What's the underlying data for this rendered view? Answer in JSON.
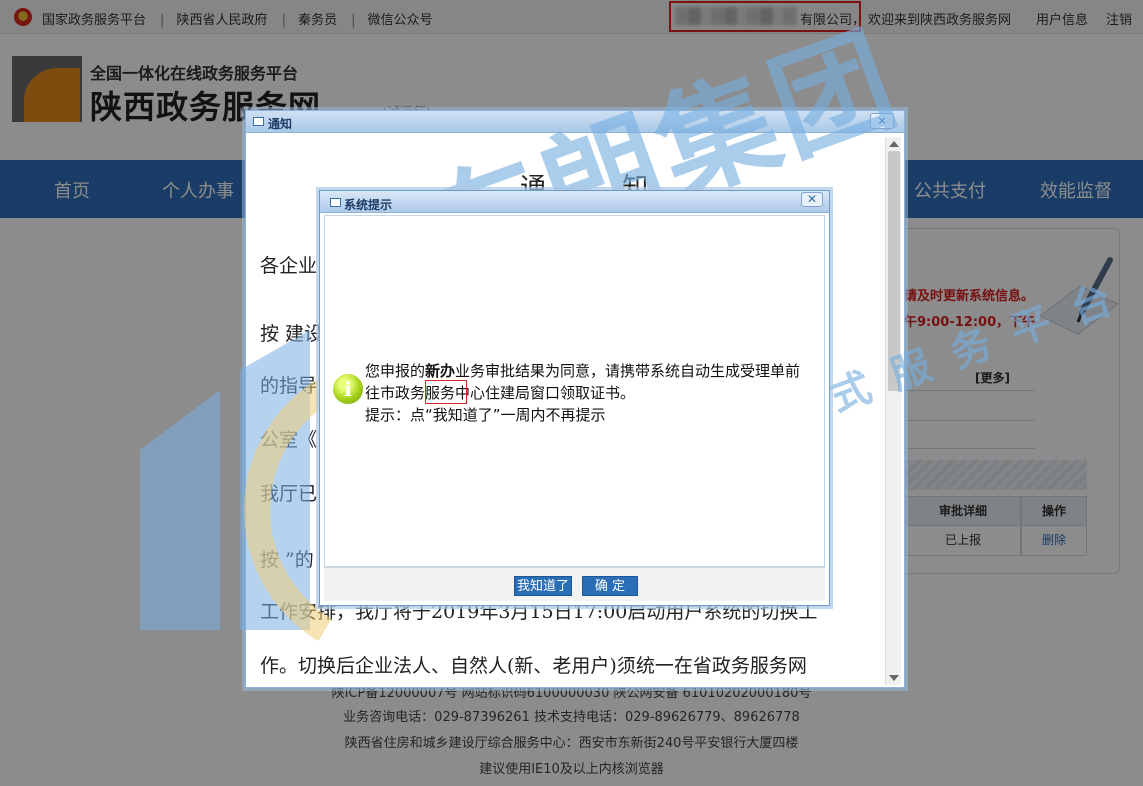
{
  "topbar": {
    "links": [
      "国家政务服务平台",
      "陕西省人民政府",
      "秦务员",
      "微信公众号"
    ],
    "company_suffix": "有限公司，",
    "welcome": "欢迎来到陕西政务服务网",
    "user_info": "用户信息",
    "logout": "注销"
  },
  "header": {
    "subtitle": "全国一体化在线政务服务平台",
    "title": "陕西政务服务网",
    "trial": "(试运行)"
  },
  "nav": {
    "items": [
      "首页",
      "个人办事",
      "公共支付",
      "效能监督"
    ]
  },
  "right_panel": {
    "red_line1": "请及时更新系统信息。",
    "red_line2": "午9:00-12:00，下午",
    "more": "[更多]",
    "table_headers": [
      "审批详细",
      "操作"
    ],
    "table_row": [
      "已上报",
      "删除"
    ]
  },
  "footer": {
    "line1": "陕ICP备12000007号   网站标识码6100000030   陕公网安备 61010202000180号",
    "line2": "业务咨询电话：029-87396261  技术支持电话：029-89626779、89626778",
    "line3": "陕西省住房和城乡建设厅综合服务中心：西安市东新街240号平安银行大厦四楼",
    "line4": "建议使用IE10及以上内核浏览器"
  },
  "notice_dialog": {
    "title": "通知",
    "heading": "通 知",
    "lines": [
      "各企业",
      "按                                                                        建设",
      "的指导                                                                    开办",
      "公室《                                                                    求，",
      "我厅已",
      "按                                                                    ”的",
      "工作安排，我厅将于2019年3月15日17:00启动用户系统的切换工",
      "作。切换后企业法人、自然人(新、老用户)须统一在省政务服务网"
    ]
  },
  "system_dialog": {
    "title": "系统提示",
    "message_pre": "您申报的",
    "message_highlight": "新办",
    "message_post": "业务审批结果为同意，请携带系统自动生成受理单前",
    "message_line2": "往市政务服务中心住建局窗口领取证书。",
    "message_line3": "提示：点“我知道了”一周内不再提示",
    "btn_know": "我知道了",
    "btn_ok": "确 定"
  },
  "watermark": {
    "main": "东朗集团",
    "sub": "建筑企业一站式服务平台"
  },
  "colors": {
    "nav_blue": "#2f6fba",
    "alert_red": "#e02222",
    "watermark_blue": "#78afe1"
  }
}
